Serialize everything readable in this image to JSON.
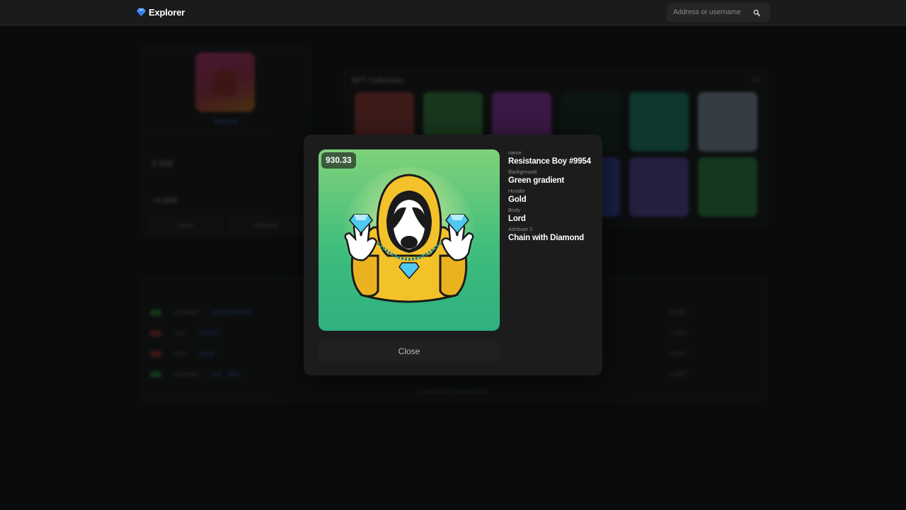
{
  "header": {
    "brand": "Explorer",
    "search_placeholder": "Address or username"
  },
  "background": {
    "profile": {
      "name": "tiemc9",
      "stat_1": "0.000",
      "stat_2": "~0.000",
      "buttons": [
        "Send",
        "Receive"
      ]
    },
    "collection": {
      "title": "NFT Collection",
      "count": "24"
    },
    "activity": {
      "rows": [
        {
          "label": "received",
          "link": "0x7d1c9e3f41",
          "right": "0.000"
        },
        {
          "label": "sent",
          "link": "0x5a0c",
          "right": "0.000"
        },
        {
          "label": "sent",
          "link": "0x12f",
          "right": "0.000"
        },
        {
          "label": "received",
          "link": "0x4…8f2a",
          "right": "0.000"
        }
      ]
    },
    "footer": "Loaded all transactions"
  },
  "modal": {
    "price": "930.33",
    "attributes": [
      {
        "key": "name",
        "value": "Resistance Boy #9954"
      },
      {
        "key": "Background",
        "value": "Green gradient"
      },
      {
        "key": "Hoodie",
        "value": "Gold"
      },
      {
        "key": "Body",
        "value": "Lord"
      },
      {
        "key": "Attribute 2",
        "value": "Chain with Diamond"
      }
    ],
    "close_label": "Close"
  },
  "colors": {
    "page_bg": "#0f1011",
    "topbar_bg": "#1a1b1c",
    "modal_bg": "#1c1c1d",
    "art_bg_top": "#7fd27a",
    "art_bg_bottom": "#2fb07f",
    "hoodie": "#f3c12a",
    "diamond": "#4fc9f0",
    "accent": "#3d8bff"
  }
}
